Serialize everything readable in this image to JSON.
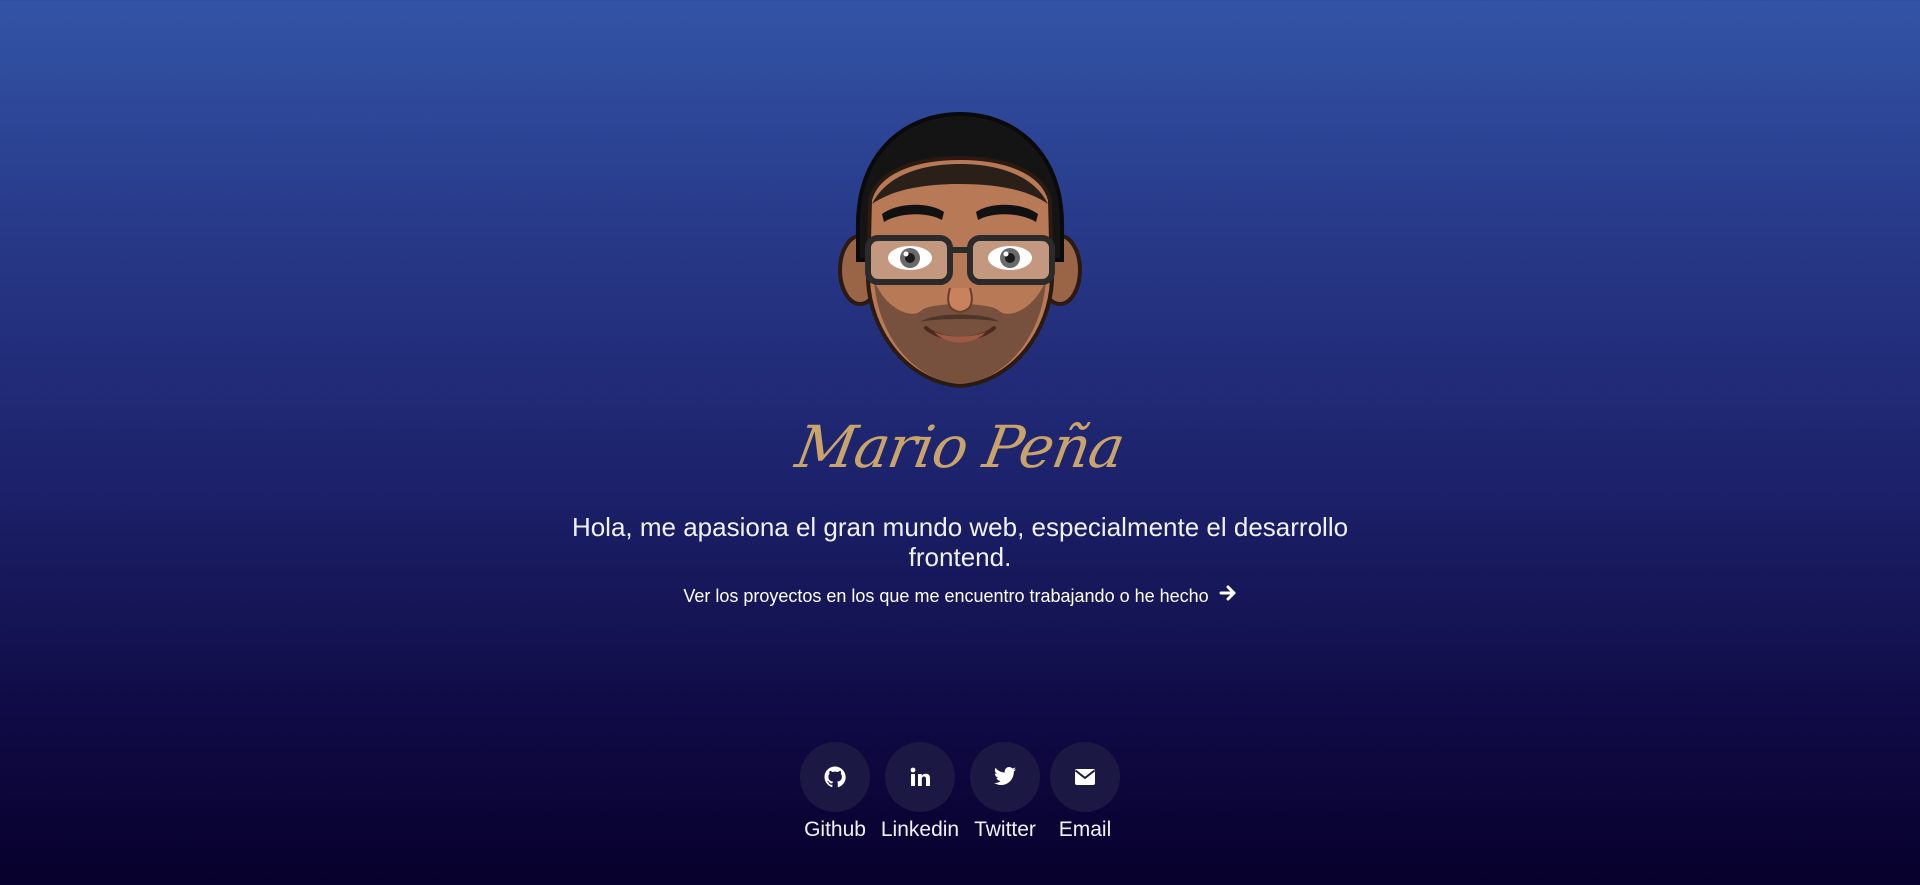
{
  "profile": {
    "name": "Mario Peña",
    "avatar_icon": "cartoon-avatar-icon",
    "tagline": "Hola, me apasiona el gran mundo web, especialmente el desarrollo frontend.",
    "projects_link": "Ver los proyectos en los que me encuentro trabajando o he hecho",
    "projects_link_icon": "arrow-right-icon"
  },
  "socials": [
    {
      "label": "Github",
      "icon": "github-icon"
    },
    {
      "label": "Linkedin",
      "icon": "linkedin-icon"
    },
    {
      "label": "Twitter",
      "icon": "twitter-icon"
    },
    {
      "label": "Email",
      "icon": "envelope-icon"
    }
  ],
  "colors": {
    "background_top": "#3354a6",
    "background_bottom": "#07002c",
    "name_gold": "#c9a46a",
    "social_circle": "#1b1843",
    "text": "#ffffff"
  }
}
